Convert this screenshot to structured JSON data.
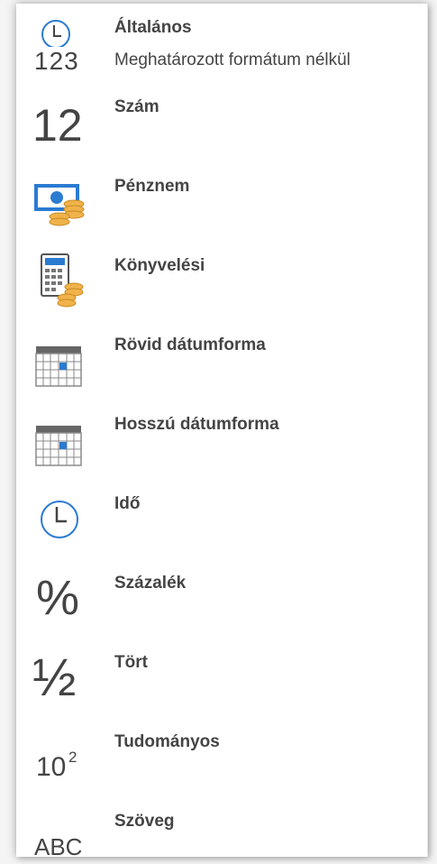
{
  "items": [
    {
      "label": "Általános",
      "desc": "Meghatározott formátum nélkül",
      "icon": "clock-123-icon",
      "glyph": "123"
    },
    {
      "label": "Szám",
      "icon": "number-icon",
      "glyph": "12"
    },
    {
      "label": "Pénznem",
      "icon": "currency-icon"
    },
    {
      "label": "Könyvelési",
      "icon": "accounting-icon"
    },
    {
      "label": "Rövid dátumforma",
      "icon": "calendar-short-icon"
    },
    {
      "label": "Hosszú dátumforma",
      "icon": "calendar-long-icon"
    },
    {
      "label": "Idő",
      "icon": "clock-icon"
    },
    {
      "label": "Százalék",
      "icon": "percent-icon",
      "glyph": "%"
    },
    {
      "label": "Tört",
      "icon": "fraction-icon",
      "glyph": "½"
    },
    {
      "label": "Tudományos",
      "icon": "scientific-icon",
      "glyph_base": "10",
      "glyph_exp": "2"
    },
    {
      "label": "Szöveg",
      "icon": "text-icon",
      "glyph": "ABC"
    }
  ],
  "colors": {
    "text": "#444444",
    "accent_blue": "#2b7bd1",
    "coin_gold": "#f0b24a",
    "calendar_grid": "#8a8a8a"
  }
}
